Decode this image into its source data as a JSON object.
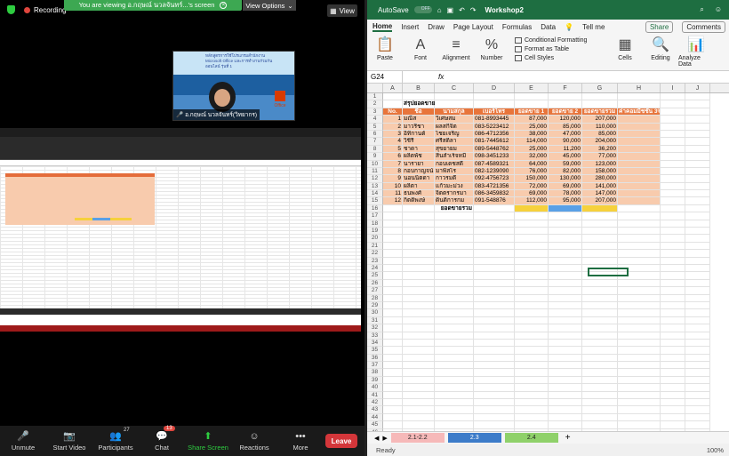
{
  "zoom": {
    "recording": "Recording",
    "viewing_banner": "You are viewing อ.กฤษณ์ นวลจันทร์...'s screen",
    "view_options": "View Options",
    "view_btn": "View",
    "video_banner": "หลักสูตรการใช้โปรแกรมสำนักงาน Microsoft Office และการทำงานร่วมกันออนไลน์ รุ่นที่ 1",
    "office_text": "Office",
    "participant_name": "อ.กฤษณ์ นวลจันทร์(วิทยากร)",
    "controls": [
      {
        "label": "Unmute",
        "icon": "🎤"
      },
      {
        "label": "Start Video",
        "icon": "📷"
      },
      {
        "label": "Participants",
        "icon": "👥",
        "count": "27"
      },
      {
        "label": "Chat",
        "icon": "💬",
        "badge": "13"
      },
      {
        "label": "Share Screen",
        "icon": "⬆"
      },
      {
        "label": "Reactions",
        "icon": "☺"
      },
      {
        "label": "More",
        "icon": "•••"
      }
    ],
    "leave": "Leave"
  },
  "excel": {
    "autosave": "AutoSave",
    "autosave_state": "OFF",
    "book": "Workshop2",
    "tabs": [
      "Home",
      "Insert",
      "Draw",
      "Page Layout",
      "Formulas",
      "Data"
    ],
    "tell_me": "Tell me",
    "share": "Share",
    "comments": "Comments",
    "groups": [
      {
        "label": "Paste",
        "icon": "📋"
      },
      {
        "label": "Font",
        "icon": "A"
      },
      {
        "label": "Alignment",
        "icon": "≡"
      },
      {
        "label": "Number",
        "icon": "%"
      }
    ],
    "styles": [
      "Conditional Formatting",
      "Format as Table",
      "Cell Styles"
    ],
    "groups2": [
      {
        "label": "Cells",
        "icon": "▦"
      },
      {
        "label": "Editing",
        "icon": "🔍"
      },
      {
        "label": "Analyze Data",
        "icon": "📊"
      }
    ],
    "name_box": "G24",
    "fx": "fx",
    "columns": [
      "A",
      "B",
      "C",
      "D",
      "E",
      "F",
      "G",
      "H",
      "I",
      "J"
    ],
    "title": "สรุปยอดขาย",
    "headers": [
      "No.",
      "ชื่อ",
      "นามสกุล",
      "เบอร์โทร",
      "ยอดขาย 1",
      "ยอดขาย 2",
      "ยอดขายรวม",
      "ค่าคอมมิชชั่น 3%"
    ],
    "rows": [
      [
        "1",
        "มณีส",
        "วิเศษสม",
        "081-8993445",
        "87,000",
        "120,000",
        "207,000"
      ],
      [
        "2",
        "มาวริชา",
        "ผลสกิจิต",
        "083-5223412",
        "25,000",
        "85,000",
        "110,000"
      ],
      [
        "3",
        "อิทิกานต์",
        "ไชยเจริญ",
        "086-4712356",
        "38,000",
        "47,000",
        "85,000"
      ],
      [
        "4",
        "วิชิรี",
        "ศรีสติลา",
        "081-7445612",
        "114,000",
        "90,000",
        "204,000"
      ],
      [
        "5",
        "ชาดา",
        "สุขยายม",
        "089-5448762",
        "25,000",
        "11,200",
        "36,200"
      ],
      [
        "6",
        "ผลิตพัช",
        "สินสำเร็จหมี",
        "098-3451233",
        "32,000",
        "45,000",
        "77,000"
      ],
      [
        "7",
        "นารายา",
        "กอบเดชสดี",
        "087-4589321",
        "64,000",
        "59,000",
        "123,000"
      ],
      [
        "8",
        "กอบกาญจน์",
        "มาพิสไร",
        "082-1239090",
        "76,000",
        "82,000",
        "158,000"
      ],
      [
        "9",
        "นอนนิตดา",
        "กาวรมดี",
        "092-4756723",
        "150,000",
        "130,000",
        "280,000"
      ],
      [
        "10",
        "ผลิตา",
        "แก้วมะม่วง",
        "083-4721356",
        "72,000",
        "69,000",
        "141,000"
      ],
      [
        "11",
        "ธนพงศ์",
        "จิตตรากรมา",
        "086-3459832",
        "69,000",
        "78,000",
        "147,000"
      ],
      [
        "12",
        "กิตติพงษ์",
        "ดินติการกม",
        "091-548876",
        "112,000",
        "95,000",
        "207,000"
      ]
    ],
    "total_label": "ยอดขายรวม",
    "sheets": [
      "2.1-2.2",
      "2.3",
      "2.4"
    ],
    "status": "Ready",
    "zoom_level": "100%"
  }
}
